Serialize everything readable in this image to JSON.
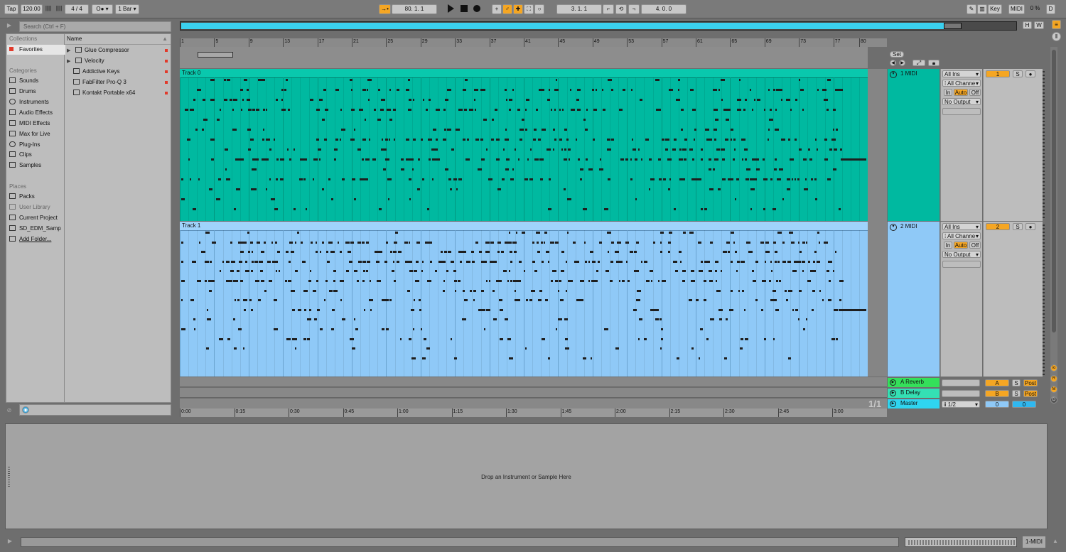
{
  "transport": {
    "tap": "Tap",
    "tempo": "120.00",
    "signature": "4 / 4",
    "metronome": "",
    "quantize": "1 Bar",
    "arrangement_pos": "80.  1.  1",
    "punch_in": "3.  1.  1",
    "loop_length": "4.  0.  0",
    "key": "Key",
    "midi": "MIDI",
    "cpu": "0 %",
    "disk": "D"
  },
  "browser": {
    "search_placeholder": "Search (Ctrl + F)",
    "collections_title": "Collections",
    "favorites": "Favorites",
    "categories_title": "Categories",
    "categories": [
      "Sounds",
      "Drums",
      "Instruments",
      "Audio Effects",
      "MIDI Effects",
      "Max for Live",
      "Plug-Ins",
      "Clips",
      "Samples"
    ],
    "places_title": "Places",
    "places": [
      "Packs",
      "User Library",
      "Current Project",
      "SD_EDM_Samp",
      "Add Folder..."
    ],
    "name_header": "Name",
    "items": [
      "Glue Compressor",
      "Velocity",
      "Addictive Keys",
      "FabFilter Pro-Q 3",
      "Kontakt Portable x64"
    ]
  },
  "ruler": {
    "bars": [
      "1",
      "5",
      "9",
      "13",
      "17",
      "21",
      "25",
      "29",
      "33",
      "37",
      "41",
      "45",
      "49",
      "53",
      "57",
      "61",
      "65",
      "69",
      "73",
      "77",
      "80"
    ],
    "times": [
      "0:00",
      "0:15",
      "0:30",
      "0:45",
      "1:00",
      "1:15",
      "1:30",
      "1:45",
      "2:00",
      "2:15",
      "2:30",
      "2:45",
      "3:00"
    ],
    "page": "1/1",
    "set_label": "Set"
  },
  "tracks": [
    {
      "clip_name": "Track 0",
      "name": "1 MIDI",
      "input": "All Ins",
      "channel": "All Channe",
      "monitor": [
        "In",
        "Auto",
        "Off"
      ],
      "output": "No Output",
      "number": "1",
      "solo": "S",
      "color": "#00b9a0"
    },
    {
      "clip_name": "Track 1",
      "name": "2 MIDI",
      "input": "All Ins",
      "channel": "All Channe",
      "monitor": [
        "In",
        "Auto",
        "Off"
      ],
      "output": "No Output",
      "number": "2",
      "solo": "S",
      "color": "#8fc9f7"
    }
  ],
  "returns": [
    {
      "name": "A Reverb",
      "letter": "A",
      "solo": "S",
      "post": "Post",
      "color": "#34e05a"
    },
    {
      "name": "B Delay",
      "letter": "B",
      "solo": "S",
      "post": "Post",
      "color": "#34e0b4"
    }
  ],
  "master": {
    "name": "Master",
    "cue": "ii 1/2",
    "vol": "0",
    "pan": "0",
    "color": "#2fd5f0"
  },
  "detail": {
    "drop_text": "Drop an Instrument or Sample Here"
  },
  "status": {
    "track_label": "1-MIDI"
  },
  "header_buttons": {
    "h": "H",
    "w": "W"
  },
  "colors": {
    "accent": "#f5a623",
    "track0": "#00b9a0",
    "track1": "#8fc9f7",
    "overview": "#3bd0ef"
  }
}
